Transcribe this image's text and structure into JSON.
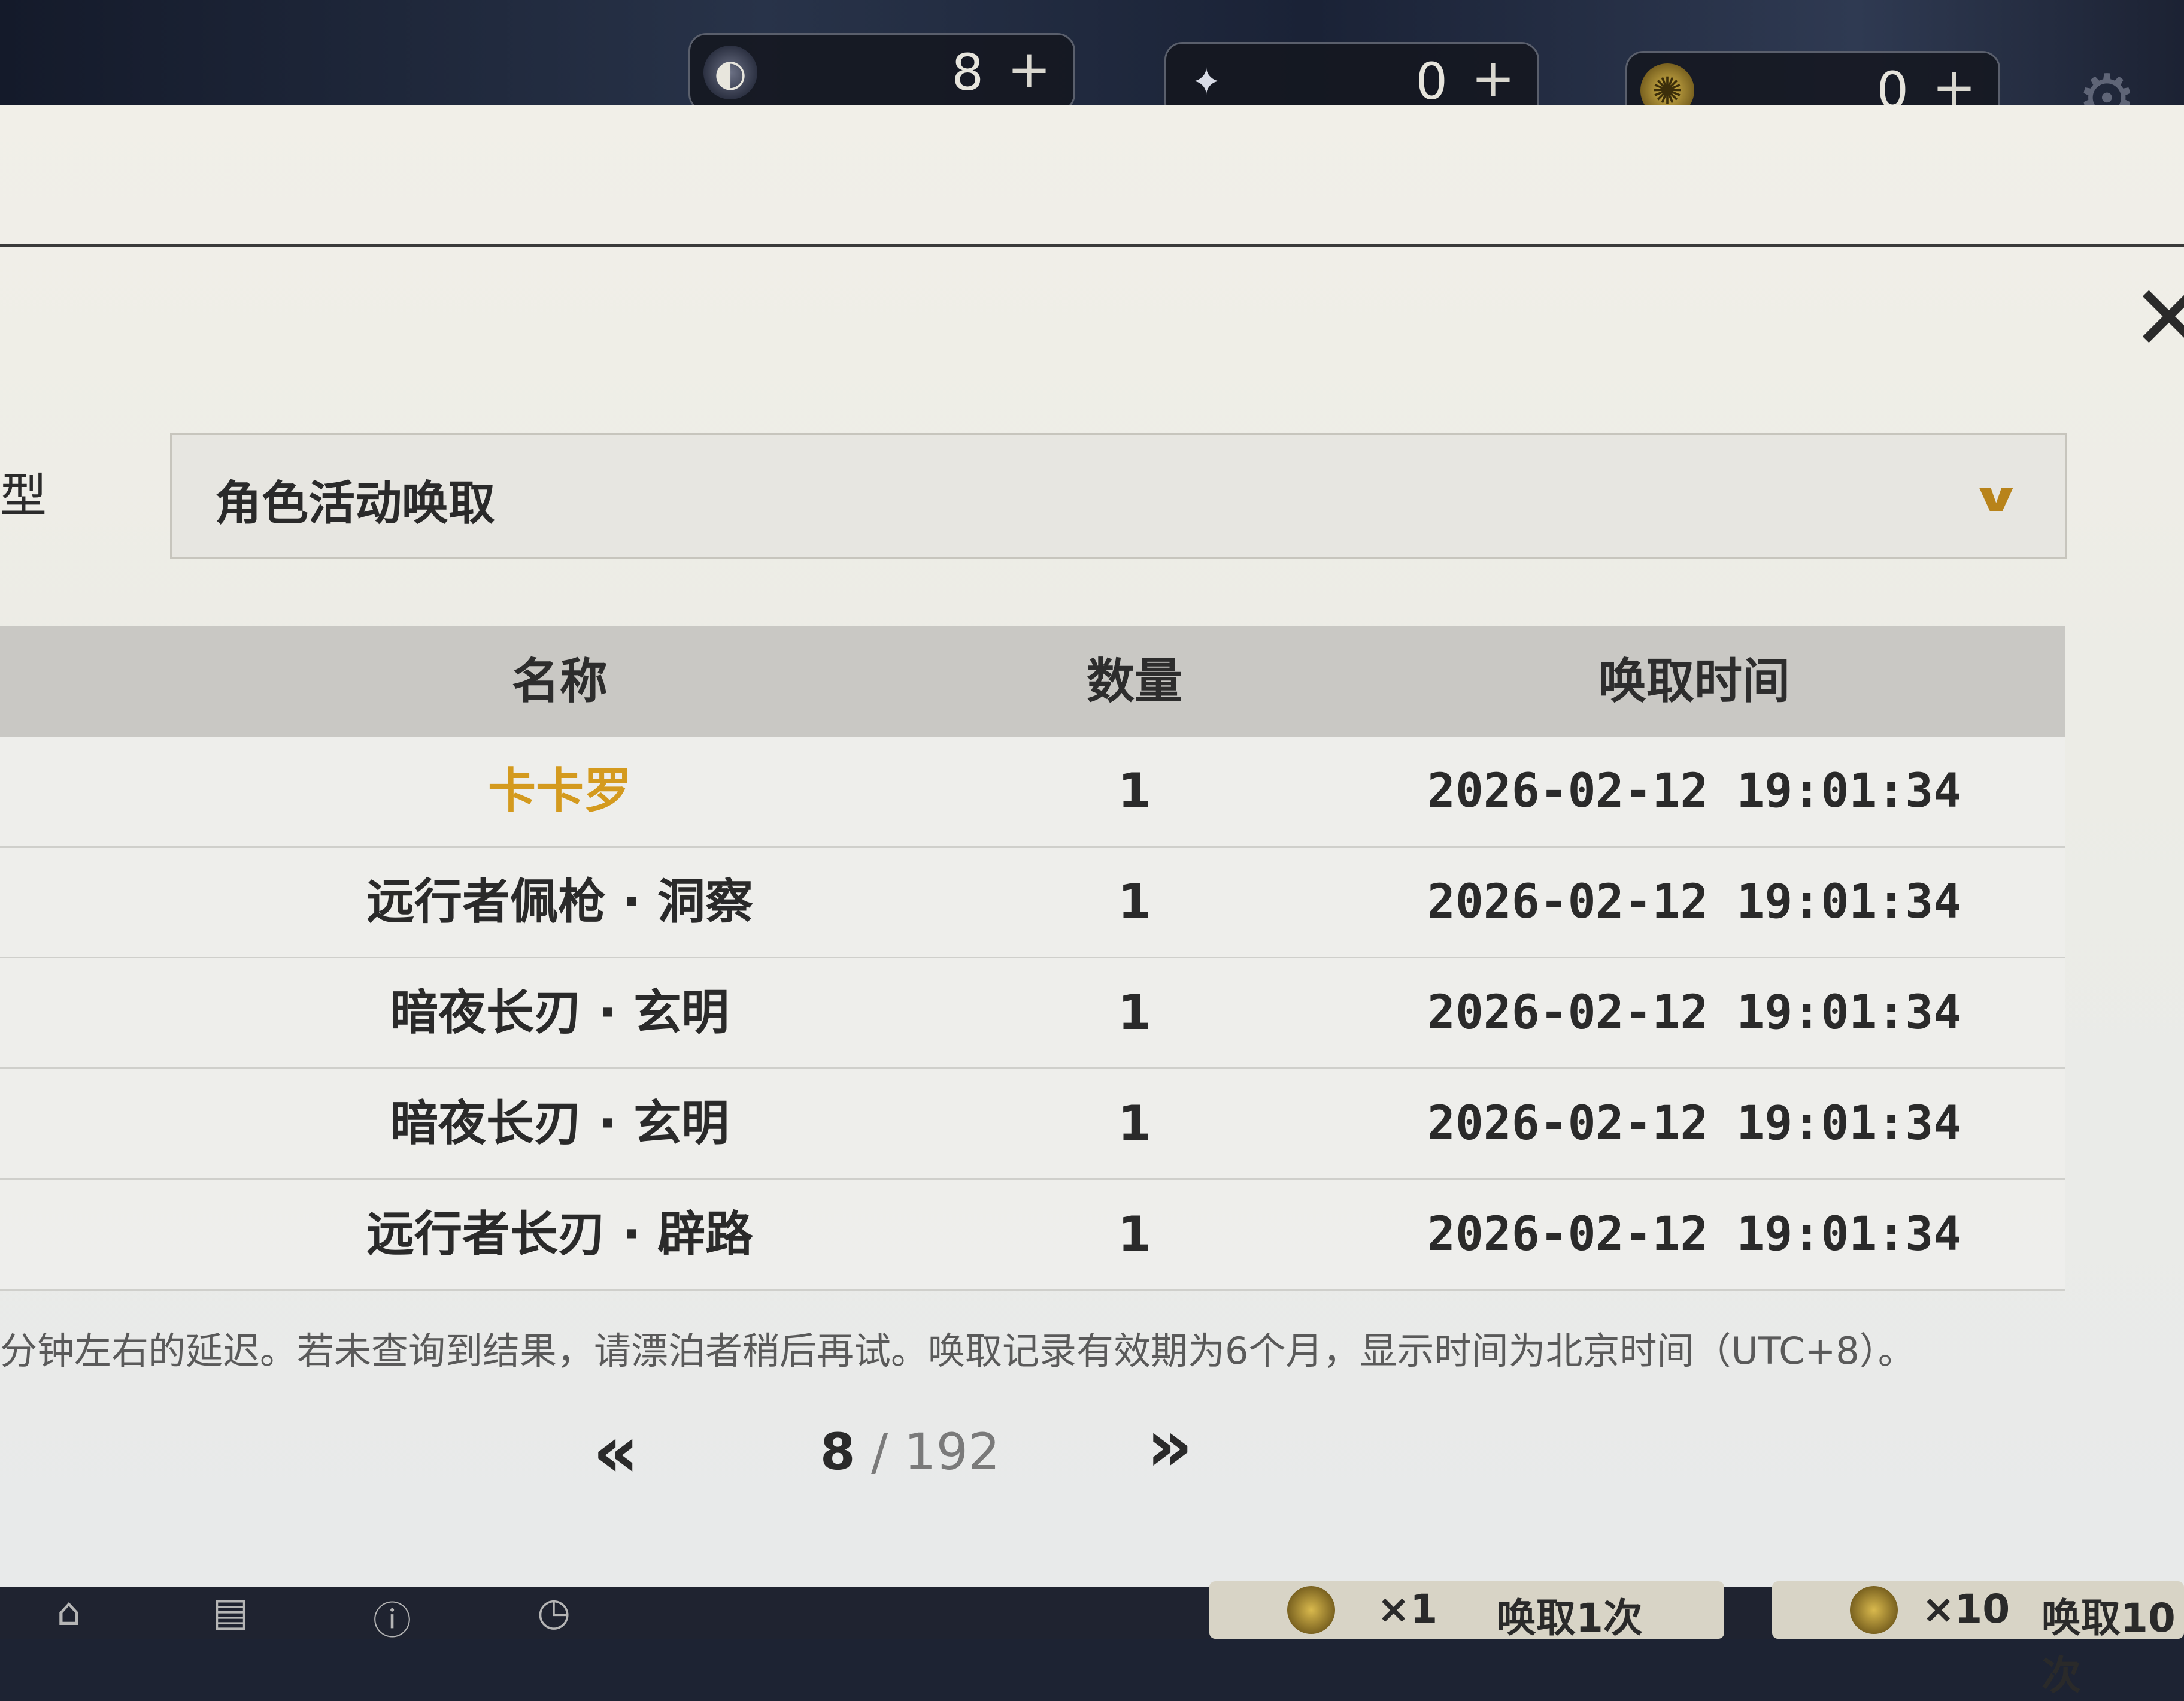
{
  "currencies": [
    {
      "icon": "lunite-icon",
      "value": "8",
      "plus": "+"
    },
    {
      "icon": "star-icon",
      "value": "0",
      "plus": "+"
    },
    {
      "icon": "coin-icon",
      "value": "0",
      "plus": "+"
    }
  ],
  "filter": {
    "label": "型",
    "selected": "角色活动唤取"
  },
  "table": {
    "headers": {
      "name": "名称",
      "qty": "数量",
      "time": "唤取时间"
    },
    "rows": [
      {
        "name": "卡卡罗",
        "qty": "1",
        "time": "2026-02-12 19:01:34",
        "highlight": "#d49a1e"
      },
      {
        "name": "远行者佩枪 · 洞察",
        "qty": "1",
        "time": "2026-02-12 19:01:34"
      },
      {
        "name": "暗夜长刃 · 玄明",
        "qty": "1",
        "time": "2026-02-12 19:01:34"
      },
      {
        "name": "暗夜长刃 · 玄明",
        "qty": "1",
        "time": "2026-02-12 19:01:34"
      },
      {
        "name": "远行者长刃 · 辟路",
        "qty": "1",
        "time": "2026-02-12 19:01:34"
      }
    ]
  },
  "note": "分钟左右的延迟。若未查询到结果，请漂泊者稍后再试。唤取记录有效期为6个月，显示时间为北京时间（UTC+8）。",
  "pagination": {
    "prev": "«",
    "current": "8",
    "separator": " / ",
    "total": "192",
    "next": "»"
  },
  "bottom": {
    "pull_one": {
      "count": "×1",
      "label": "唤取1次"
    },
    "pull_ten": {
      "count": "×10",
      "label": "唤取10次"
    }
  }
}
